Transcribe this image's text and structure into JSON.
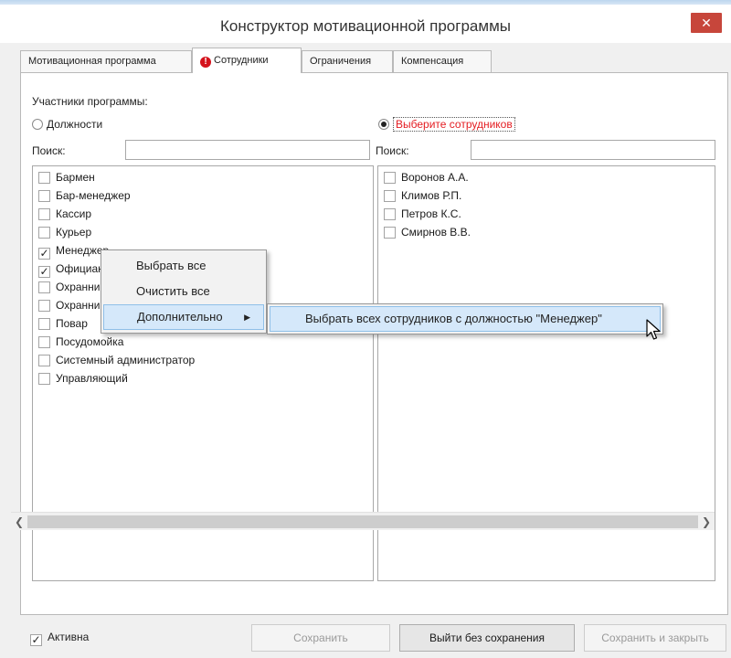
{
  "window": {
    "title": "Конструктор мотивационной программы",
    "close_icon": "✕"
  },
  "tabs": [
    {
      "label": "Мотивационная программа",
      "active": false,
      "warning": false
    },
    {
      "label": "Сотрудники",
      "active": true,
      "warning": true,
      "warning_icon": "!"
    },
    {
      "label": "Ограничения",
      "active": false,
      "warning": false
    },
    {
      "label": "Компенсация",
      "active": false,
      "warning": false
    }
  ],
  "participants": {
    "label": "Участники программы:",
    "positions_radio": "Должности",
    "employees_radio": "Выберите сотрудников",
    "selected": "employees"
  },
  "search": {
    "left_label": "Поиск:",
    "left_value": "",
    "right_label": "Поиск:",
    "right_value": ""
  },
  "positions": [
    {
      "label": "Бармен",
      "checked": false
    },
    {
      "label": "Бар-менеджер",
      "checked": false
    },
    {
      "label": "Кассир",
      "checked": false
    },
    {
      "label": "Курьер",
      "checked": false
    },
    {
      "label": "Менеджер",
      "checked": true
    },
    {
      "label": "Официант",
      "checked": true
    },
    {
      "label": "Охранник",
      "checked": false
    },
    {
      "label": "Охранник",
      "checked": false
    },
    {
      "label": "Повар",
      "checked": false
    },
    {
      "label": "Посудомойка",
      "checked": false
    },
    {
      "label": "Системный администратор",
      "checked": false
    },
    {
      "label": "Управляющий",
      "checked": false
    }
  ],
  "employees": [
    {
      "label": "Воронов А.А.",
      "checked": false
    },
    {
      "label": "Климов Р.П.",
      "checked": false
    },
    {
      "label": "Петров К.С.",
      "checked": false
    },
    {
      "label": "Смирнов В.В.",
      "checked": false
    }
  ],
  "context_menu": {
    "items": [
      {
        "label": "Выбрать все"
      },
      {
        "label": "Очистить все"
      },
      {
        "label": "Дополнительно",
        "submenu_arrow": "▶",
        "highlighted": true
      }
    ],
    "submenu": {
      "items": [
        {
          "label": "Выбрать всех сотрудников с должностью \"Менеджер\"",
          "highlighted": true
        }
      ]
    }
  },
  "scrollbar": {
    "left_arrow": "❮",
    "right_arrow": "❯"
  },
  "footer": {
    "active_checkbox": {
      "label": "Активна",
      "checked": true
    },
    "save_label": "Сохранить",
    "save_enabled": false,
    "exit_label": "Выйти без сохранения",
    "save_close_label": "Сохранить и закрыть",
    "save_close_enabled": false
  },
  "colors": {
    "close_button": "#c7463b",
    "warning": "#d4121c",
    "required_text": "#e41d22",
    "menu_highlight": "#d5e8fa"
  }
}
